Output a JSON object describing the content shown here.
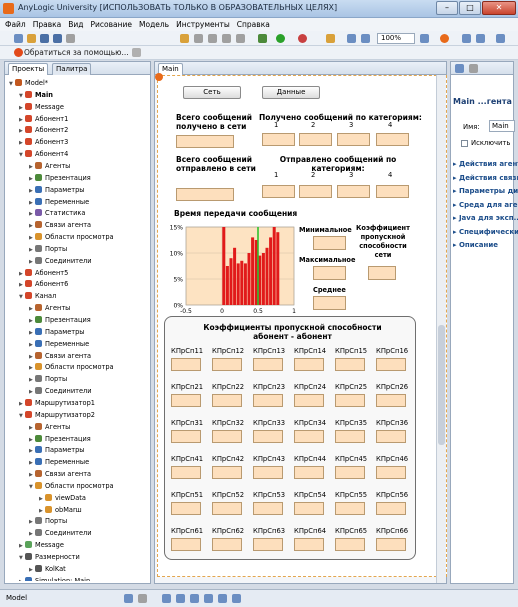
{
  "window": {
    "title": "AnyLogic University [ИСПОЛЬЗОВАТЬ ТОЛЬКО В ОБРАЗОВАТЕЛЬНЫХ ЦЕЛЯХ]",
    "min": "–",
    "max": "□",
    "close": "✕"
  },
  "menu": [
    "Файл",
    "Правка",
    "Вид",
    "Рисование",
    "Модель",
    "Инструменты",
    "Справка"
  ],
  "toolbar": {
    "zoom": "100%",
    "help_link": "Обратиться за помощью..."
  },
  "left_panel": {
    "tabs": [
      "Проекты",
      "Палитра"
    ],
    "tree": [
      {
        "label": "Model*",
        "level": 0,
        "expanded": true,
        "bold": false,
        "icon_color": "#c2581f"
      },
      {
        "label": "Main",
        "level": 1,
        "expanded": true,
        "bold": true,
        "icon_color": "#d4462a"
      },
      {
        "label": "Message",
        "level": 1,
        "expanded": false,
        "bold": false,
        "icon_color": "#d4462a"
      },
      {
        "label": "Абонент1",
        "level": 1,
        "expanded": false,
        "bold": false,
        "icon_color": "#d4462a"
      },
      {
        "label": "Абонент2",
        "level": 1,
        "expanded": false,
        "bold": false,
        "icon_color": "#d4462a"
      },
      {
        "label": "Абонент3",
        "level": 1,
        "expanded": false,
        "bold": false,
        "icon_color": "#d4462a"
      },
      {
        "label": "Абонент4",
        "level": 1,
        "expanded": true,
        "bold": false,
        "icon_color": "#d4462a"
      },
      {
        "label": "Агенты",
        "level": 2,
        "expanded": false,
        "bold": false,
        "icon_color": "#b7642f"
      },
      {
        "label": "Презентация",
        "level": 2,
        "expanded": false,
        "bold": false,
        "icon_color": "#4c8a3a"
      },
      {
        "label": "Параметры",
        "level": 2,
        "expanded": false,
        "bold": false,
        "icon_color": "#3a6fb5"
      },
      {
        "label": "Переменные",
        "level": 2,
        "expanded": false,
        "bold": false,
        "icon_color": "#3a6fb5"
      },
      {
        "label": "Статистика",
        "level": 2,
        "expanded": false,
        "bold": false,
        "icon_color": "#7a5aa8"
      },
      {
        "label": "Связи агента",
        "level": 2,
        "expanded": false,
        "bold": false,
        "icon_color": "#b7642f"
      },
      {
        "label": "Области просмотра",
        "level": 2,
        "expanded": false,
        "bold": false,
        "icon_color": "#d9932c"
      },
      {
        "label": "Порты",
        "level": 2,
        "expanded": false,
        "bold": false,
        "icon_color": "#777777"
      },
      {
        "label": "Соединители",
        "level": 2,
        "expanded": false,
        "bold": false,
        "icon_color": "#777777"
      },
      {
        "label": "Абонент5",
        "level": 1,
        "expanded": false,
        "bold": false,
        "icon_color": "#d4462a"
      },
      {
        "label": "Абонент6",
        "level": 1,
        "expanded": false,
        "bold": false,
        "icon_color": "#d4462a"
      },
      {
        "label": "Канал",
        "level": 1,
        "expanded": true,
        "bold": false,
        "icon_color": "#d4462a"
      },
      {
        "label": "Агенты",
        "level": 2,
        "expanded": false,
        "bold": false,
        "icon_color": "#b7642f"
      },
      {
        "label": "Презентация",
        "level": 2,
        "expanded": false,
        "bold": false,
        "icon_color": "#4c8a3a"
      },
      {
        "label": "Параметры",
        "level": 2,
        "expanded": false,
        "bold": false,
        "icon_color": "#3a6fb5"
      },
      {
        "label": "Переменные",
        "level": 2,
        "expanded": false,
        "bold": false,
        "icon_color": "#3a6fb5"
      },
      {
        "label": "Связи агента",
        "level": 2,
        "expanded": false,
        "bold": false,
        "icon_color": "#b7642f"
      },
      {
        "label": "Области просмотра",
        "level": 2,
        "expanded": false,
        "bold": false,
        "icon_color": "#d9932c"
      },
      {
        "label": "Порты",
        "level": 2,
        "expanded": false,
        "bold": false,
        "icon_color": "#777777"
      },
      {
        "label": "Соединители",
        "level": 2,
        "expanded": false,
        "bold": false,
        "icon_color": "#777777"
      },
      {
        "label": "Маршрутизатор1",
        "level": 1,
        "expanded": false,
        "bold": false,
        "icon_color": "#d4462a"
      },
      {
        "label": "Маршрутизатор2",
        "level": 1,
        "expanded": true,
        "bold": false,
        "icon_color": "#d4462a"
      },
      {
        "label": "Агенты",
        "level": 2,
        "expanded": false,
        "bold": false,
        "icon_color": "#b7642f"
      },
      {
        "label": "Презентация",
        "level": 2,
        "expanded": false,
        "bold": false,
        "icon_color": "#4c8a3a"
      },
      {
        "label": "Параметры",
        "level": 2,
        "expanded": false,
        "bold": false,
        "icon_color": "#3a6fb5"
      },
      {
        "label": "Переменные",
        "level": 2,
        "expanded": false,
        "bold": false,
        "icon_color": "#3a6fb5"
      },
      {
        "label": "Связи агента",
        "level": 2,
        "expanded": false,
        "bold": false,
        "icon_color": "#b7642f"
      },
      {
        "label": "Области просмотра",
        "level": 2,
        "expanded": true,
        "bold": false,
        "icon_color": "#d9932c"
      },
      {
        "label": "viewData",
        "level": 3,
        "expanded": false,
        "bold": false,
        "icon_color": "#d9932c"
      },
      {
        "label": "obMarш",
        "level": 3,
        "expanded": false,
        "bold": false,
        "icon_color": "#d9932c"
      },
      {
        "label": "Порты",
        "level": 2,
        "expanded": false,
        "bold": false,
        "icon_color": "#777777"
      },
      {
        "label": "Соединители",
        "level": 2,
        "expanded": false,
        "bold": false,
        "icon_color": "#777777"
      },
      {
        "label": "Message",
        "level": 1,
        "expanded": false,
        "bold": false,
        "icon_color": "#5aa35a"
      },
      {
        "label": "Размерности",
        "level": 1,
        "expanded": true,
        "bold": false,
        "icon_color": "#555555"
      },
      {
        "label": "KolKat",
        "level": 2,
        "expanded": false,
        "bold": false,
        "icon_color": "#555555"
      },
      {
        "label": "Simulation: Main",
        "level": 1,
        "expanded": false,
        "bold": false,
        "icon_color": "#3a6fb5"
      }
    ]
  },
  "editor": {
    "tab": "Main",
    "btn_network": "Сеть",
    "btn_data": "Данные",
    "total_received": "Всего сообщений получено в сети",
    "received_by_category": "Получено сообщений по категориям:",
    "total_sent": "Всего сообщений отправлено в сети",
    "sent_by_category": "Отправлено сообщений по категориям:",
    "categories": [
      "1",
      "2",
      "3",
      "4"
    ],
    "transfer_time": "Время передачи сообщения",
    "min_label": "Минимальное",
    "max_label": "Максимальное",
    "avg_label": "Среднее",
    "capacity_label": "Коэффициент пропускной способности сети",
    "matrix_title": "Коэффициенты пропускной способности абонент - абонент",
    "matrix_cells": [
      [
        "КПрСп11",
        "КПрСп12",
        "КПрСп13",
        "КПрСп14",
        "КПрСп15",
        "КПрСп16"
      ],
      [
        "КПрСп21",
        "КПрСп22",
        "КПрСп23",
        "КПрСп24",
        "КПрСп25",
        "КПрСп26"
      ],
      [
        "КПрСп31",
        "КПрСп32",
        "КПрСп33",
        "КПрСп34",
        "КПрСп35",
        "КПрСп36"
      ],
      [
        "КПрСп41",
        "КПрСп42",
        "КПрСп43",
        "КПрСп44",
        "КПрСп45",
        "КПрСп46"
      ],
      [
        "КПрСп51",
        "КПрСп52",
        "КПрСп53",
        "КПрСп54",
        "КПрСп55",
        "КПрСп56"
      ],
      [
        "КПрСп61",
        "КПрСп62",
        "КПрСп63",
        "КПрСп64",
        "КПрСп65",
        "КПрСп66"
      ]
    ]
  },
  "chart_data": {
    "type": "bar",
    "title": "",
    "x_ticks": [
      "-0.5",
      "0",
      "0.5",
      "1"
    ],
    "y_ticks": [
      "15%",
      "10%",
      "5%",
      "0%"
    ],
    "xlim": [
      -0.5,
      1
    ],
    "ylim": [
      0,
      15
    ],
    "bins_x": [
      0.05,
      0.1,
      0.15,
      0.2,
      0.25,
      0.3,
      0.35,
      0.4,
      0.45,
      0.5,
      0.55,
      0.6,
      0.65,
      0.7,
      0.75,
      0.8
    ],
    "values": [
      15,
      7.5,
      9,
      11,
      8,
      8.5,
      8,
      10,
      13,
      12.5,
      9.5,
      10,
      11,
      13,
      15,
      14
    ],
    "marker_x": 0.5,
    "bar_color": "#e11a1a",
    "marker_color": "#2ec22e",
    "background": "#fde3c2"
  },
  "right_panel": {
    "tab_title": "Main ...гента",
    "name_label": "Имя:",
    "name_value": "Main",
    "exclude_label": "Исключить",
    "sections": [
      "Действия агента",
      "Действия связи",
      "Параметры ди...",
      "Среда для агент...",
      "Java для эксп...",
      "Специфические",
      "Описание"
    ]
  },
  "statusbar": {
    "left": "Model"
  }
}
